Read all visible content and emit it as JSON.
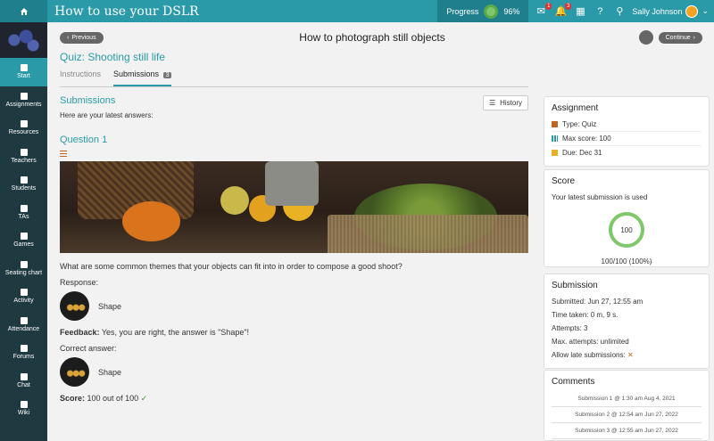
{
  "topbar": {
    "title": "How to use your DSLR",
    "progress_label": "Progress",
    "progress_value": "96%",
    "progress_fraction": 0.96,
    "badges": {
      "assignments": "1",
      "notifications": "3"
    },
    "user_name": "Sally Johnson"
  },
  "sidebar": {
    "items": [
      {
        "label": "Start",
        "icon": "start-icon",
        "active": true
      },
      {
        "label": "Assignments",
        "icon": "assignments-icon"
      },
      {
        "label": "Resources",
        "icon": "resources-icon"
      },
      {
        "label": "Teachers",
        "icon": "teachers-icon"
      },
      {
        "label": "Students",
        "icon": "students-icon"
      },
      {
        "label": "TAs",
        "icon": "tas-icon"
      },
      {
        "label": "Games",
        "icon": "games-icon"
      },
      {
        "label": "Seating chart",
        "icon": "seating-chart-icon"
      },
      {
        "label": "Activity",
        "icon": "activity-icon"
      },
      {
        "label": "Attendance",
        "icon": "attendance-icon"
      },
      {
        "label": "Forums",
        "icon": "forums-icon"
      },
      {
        "label": "Chat",
        "icon": "chat-icon"
      },
      {
        "label": "Wiki",
        "icon": "wiki-icon"
      }
    ]
  },
  "header": {
    "previous_label": "Previous",
    "page_title": "How to photograph still objects",
    "continue_label": "Continue"
  },
  "quiz": {
    "title": "Quiz: Shooting still life",
    "tabs": [
      {
        "label": "Instructions"
      },
      {
        "label": "Submissions",
        "count": "3"
      }
    ]
  },
  "submissions": {
    "title": "Submissions",
    "history_label": "History",
    "subtitle": "Here are your latest answers:",
    "question_title": "Question 1",
    "question_text": "What are some common themes that your objects can fit into in order to compose a good shoot?",
    "response_label": "Response:",
    "response_value": "Shape",
    "feedback_label": "Feedback:",
    "feedback_text": "Yes, you are right, the answer is \"Shape\"!",
    "correct_label": "Correct answer:",
    "correct_value": "Shape",
    "score_label": "Score:",
    "score_text": "100 out of 100"
  },
  "assignment": {
    "title": "Assignment",
    "type": "Type: Quiz",
    "max_score": "Max score: 100",
    "due": "Due: Dec 31"
  },
  "score": {
    "title": "Score",
    "note": "Your latest submission is used",
    "value": "100",
    "summary": "100/100 (100%)"
  },
  "submission": {
    "title": "Submission",
    "submitted": "Submitted: Jun 27, 12:55 am",
    "time_taken": "Time taken: 0 m, 9 s.",
    "attempts": "Attempts: 3",
    "max_attempts": "Max. attempts: unlimited",
    "late": "Allow late submissions:"
  },
  "comments": {
    "title": "Comments",
    "items": [
      "Submission 1 @ 1:30 am Aug 4, 2021",
      "Submission 2 @ 12:54 am Jun 27, 2022",
      "Submission 3 @ 12:55 am Jun 27, 2022"
    ]
  },
  "colors": {
    "accent": "#2a9aa8",
    "sidebar": "#1e3940",
    "success": "#7ec86b"
  }
}
